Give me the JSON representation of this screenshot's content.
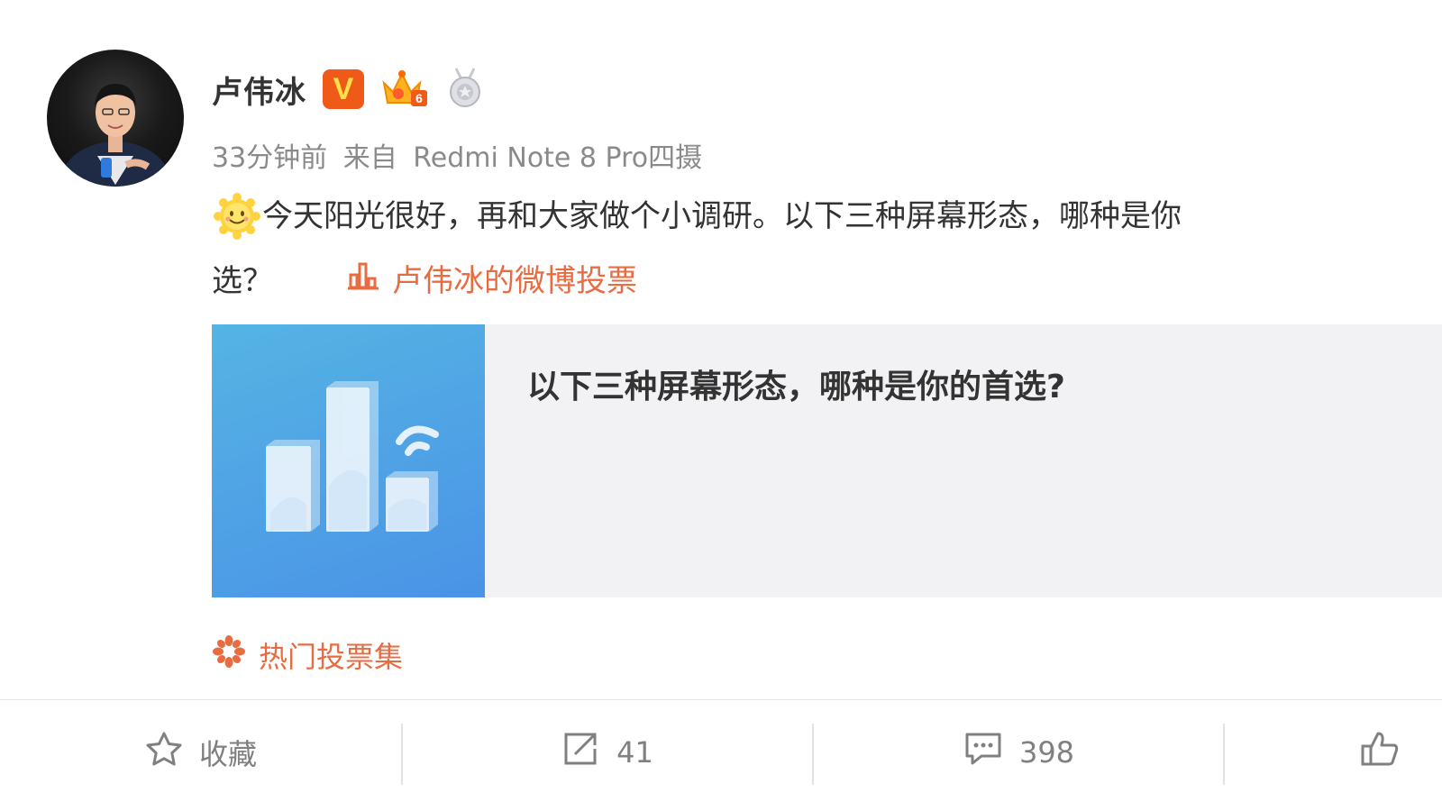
{
  "user": {
    "name": "卢伟冰",
    "verified_badge": "V",
    "level_badge": "6",
    "accent_color": "#f05a18"
  },
  "meta": {
    "time": "33分钟前",
    "from_label": "来自",
    "device": "Redmi Note 8 Pro四摄"
  },
  "post": {
    "text_line1": "今天阳光很好，再和大家做个小调研。以下三种屏幕形态，哪种是你",
    "text_line2": "选？",
    "vote_link": "卢伟冰的微博投票",
    "link_color": "#e86c42"
  },
  "poll_card": {
    "title": "以下三种屏幕形态，哪种是你的首选?"
  },
  "hot_votes": {
    "label": "热门投票集"
  },
  "actions": {
    "favorite": "收藏",
    "repost": "41",
    "comment": "398"
  },
  "icons": {
    "avatar": "user-avatar",
    "verified": "verified-v-icon",
    "crown": "crown-level-icon",
    "medal": "medal-icon",
    "emoji": "sun-smile-emoji-icon",
    "vote": "bar-chart-icon",
    "hot": "flower-icon",
    "favorite": "star-icon",
    "repost": "share-icon",
    "comment": "comment-icon",
    "like": "thumbs-up-icon"
  }
}
